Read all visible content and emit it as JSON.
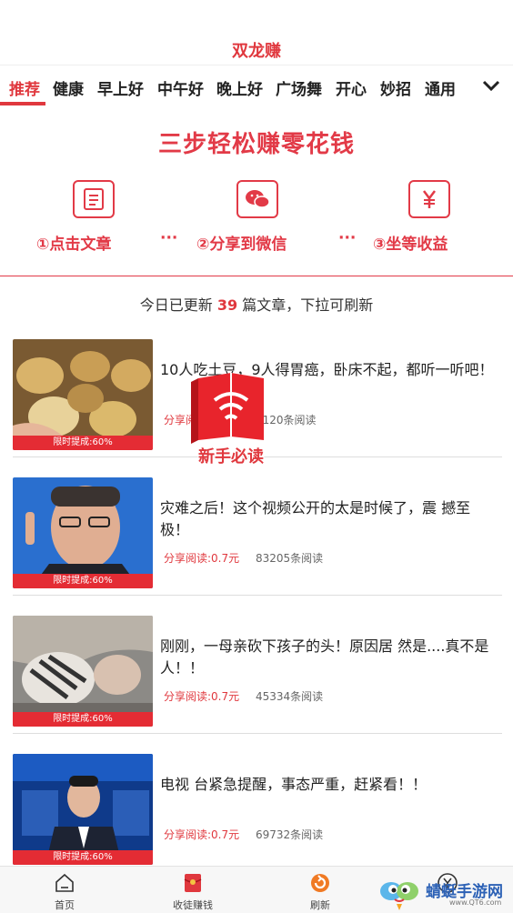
{
  "app": {
    "title": "双龙赚"
  },
  "tabs": [
    {
      "label": "推荐",
      "active": true
    },
    {
      "label": "健康"
    },
    {
      "label": "早上好"
    },
    {
      "label": "中午好"
    },
    {
      "label": "晚上好"
    },
    {
      "label": "广场舞"
    },
    {
      "label": "开心"
    },
    {
      "label": "妙招"
    },
    {
      "label": "通用"
    }
  ],
  "banner": {
    "title": "三步轻松赚零花钱",
    "steps": [
      {
        "label": "①点击文章",
        "icon": "document-icon"
      },
      {
        "label": "②分享到微信",
        "icon": "wechat-icon"
      },
      {
        "label": "③坐等收益",
        "icon": "yuan-icon"
      }
    ],
    "separator": "···"
  },
  "notice": {
    "prefix": "今日已更新",
    "count": "39",
    "suffix": "篇文章，下拉可刷新"
  },
  "articles": [
    {
      "title": "10人吃土豆，9人得胃癌，卧床不起，都听一听吧！",
      "reward": "分享阅读:0.7元",
      "reads": "4120条阅读",
      "tag": "限时提成:60%"
    },
    {
      "title": "灾难之后！这个视频公开的太是时候了，震 撼至极！",
      "reward": "分享阅读:0.7元",
      "reads": "83205条阅读",
      "tag": "限时提成:60%"
    },
    {
      "title": "刚刚，一母亲砍下孩子的头！原因居 然是....真不是人！！",
      "reward": "分享阅读:0.7元",
      "reads": "45334条阅读",
      "tag": "限时提成:60%"
    },
    {
      "title": "电视 台紧急提醒，事态严重，赶紧看！！",
      "reward": "分享阅读:0.7元",
      "reads": "69732条阅读",
      "tag": "限时提成:60%"
    }
  ],
  "promo": {
    "label": "新手必读"
  },
  "nav": [
    {
      "label": "首页",
      "icon": "home-icon"
    },
    {
      "label": "收徒赚钱",
      "icon": "red-envelope-icon"
    },
    {
      "label": "刷新",
      "icon": "refresh-icon"
    },
    {
      "label": "",
      "icon": "yuan-icon"
    }
  ],
  "watermark": {
    "text": "蜻蜓手游网",
    "url": "www.QT6.com"
  },
  "colors": {
    "accent": "#e0383e",
    "nav_bg": "#f7f7f7"
  }
}
